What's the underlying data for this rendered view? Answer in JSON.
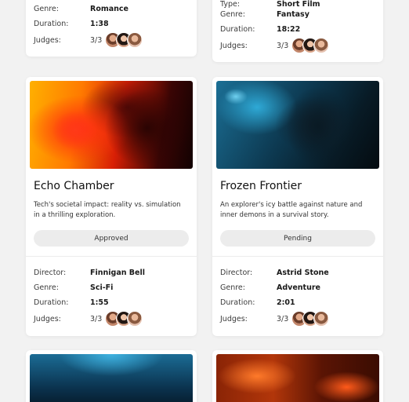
{
  "labels": {
    "type": "Type:",
    "director": "Director:",
    "genre": "Genre:",
    "duration": "Duration:",
    "judges": "Judges:"
  },
  "top_cards": [
    {
      "type": "",
      "genre": "Romance",
      "duration": "1:38",
      "judges": "3/3"
    },
    {
      "type": "Short Film",
      "genre": "Fantasy",
      "duration": "18:22",
      "judges": "3/3"
    }
  ],
  "cards": [
    {
      "image": "portrait-red-orange-image",
      "title": "Echo Chamber",
      "description": "Tech's societal impact: reality vs. simulation in a thrilling exploration.",
      "status": "Approved",
      "director": "Finnigan Bell",
      "genre": "Sci-Fi",
      "duration": "1:55",
      "judges": "3/3"
    },
    {
      "image": "portrait-blue-night-image",
      "title": "Frozen Frontier",
      "description": "An explorer's icy battle against nature and inner demons in a survival story.",
      "status": "Pending",
      "director": "Astrid Stone",
      "genre": "Adventure",
      "duration": "2:01",
      "judges": "3/3"
    }
  ]
}
